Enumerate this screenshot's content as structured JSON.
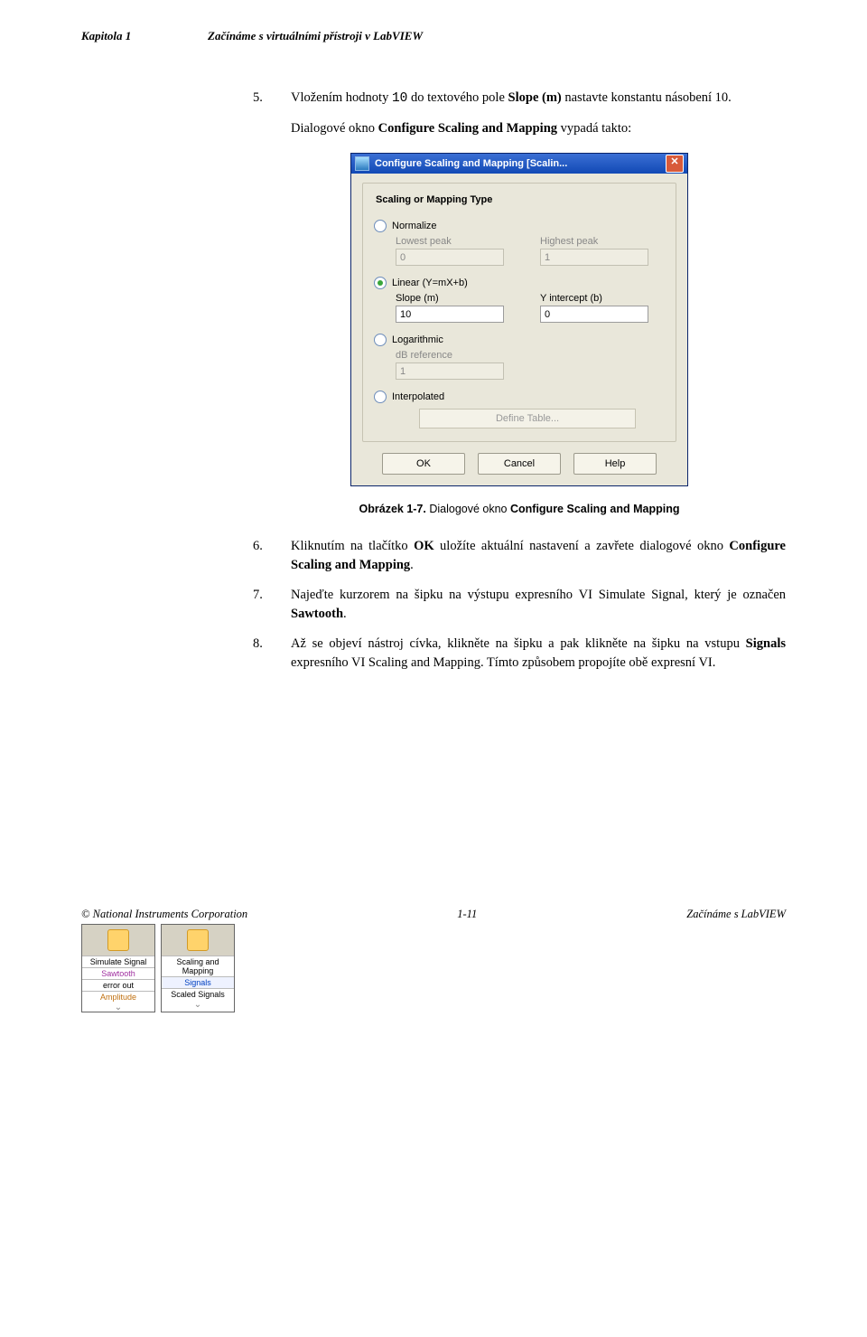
{
  "header": {
    "left": "Kapitola 1",
    "right": "Začínáme s virtuálními přístroji v LabVIEW"
  },
  "steps": {
    "s5": {
      "num": "5.",
      "pre": "Vložením hodnoty ",
      "code": "10",
      "mid": " do textového pole ",
      "bold1": "Slope (m)",
      "post": " nastavte konstantu násobení 10."
    },
    "intro2a": "Dialogové okno ",
    "intro2b": "Configure Scaling and Mapping",
    "intro2c": " vypadá takto:",
    "s6": {
      "num": "6.",
      "a": "Kliknutím na tlačítko ",
      "bold1": "OK",
      "b": " uložíte aktuální nastavení a zavřete dialogové okno ",
      "bold2": "Configure Scaling and Mapping",
      "c": "."
    },
    "s7": {
      "num": "7.",
      "a": "Najeďte kurzorem na šipku na výstupu expresního VI Simulate Signal, který je označen ",
      "bold1": "Sawtooth",
      "b": "."
    },
    "s8": {
      "num": "8.",
      "a": "Až se objeví nástroj cívka, klikněte na šipku a pak klikněte na šipku na vstupu ",
      "bold1": "Signals",
      "b": " expresního VI Scaling and Mapping. Tímto způsobem propojíte obě expresní VI."
    }
  },
  "dialog": {
    "title": "Configure Scaling and Mapping [Scalin...",
    "groupTitle": "Scaling or Mapping Type",
    "normalize": "Normalize",
    "lowest": "Lowest peak",
    "highest": "Highest peak",
    "lowVal": "0",
    "highVal": "1",
    "linear": "Linear (Y=mX+b)",
    "slope": "Slope (m)",
    "yint": "Y intercept (b)",
    "slopeVal": "10",
    "yintVal": "0",
    "log": "Logarithmic",
    "dbref": "dB reference",
    "dbVal": "1",
    "interp": "Interpolated",
    "define": "Define Table...",
    "ok": "OK",
    "cancel": "Cancel",
    "help": "Help"
  },
  "caption": {
    "a": "Obrázek 1-7.",
    "b": " Dialogové okno ",
    "c": "Configure Scaling and Mapping"
  },
  "sidefig": {
    "box1": {
      "title": "Simulate Signal",
      "r1": "Sawtooth",
      "r2": "error out",
      "r3": "Amplitude"
    },
    "box2": {
      "title": "Scaling and Mapping",
      "r1": "Signals",
      "r2": "Scaled Signals"
    }
  },
  "footer": {
    "left": "© National Instruments Corporation",
    "mid": "1-11",
    "right": "Začínáme s LabVIEW"
  }
}
